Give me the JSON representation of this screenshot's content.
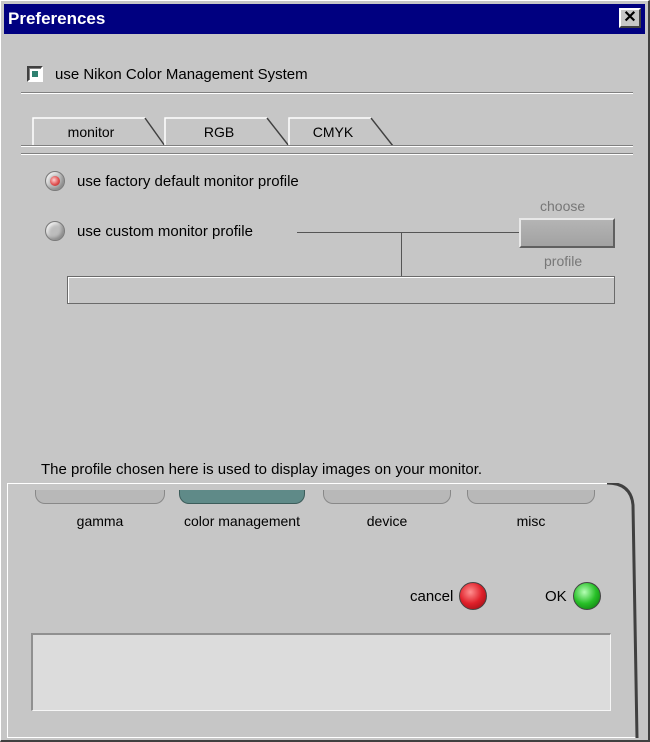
{
  "window": {
    "title": "Preferences",
    "close_glyph": "✕"
  },
  "ncms": {
    "label": "use Nikon Color Management System",
    "checked": true
  },
  "tabs": [
    {
      "label": "monitor",
      "selected": true
    },
    {
      "label": "RGB",
      "selected": false
    },
    {
      "label": "CMYK",
      "selected": false
    }
  ],
  "radios": [
    {
      "label": "use factory default monitor profile",
      "selected": true
    },
    {
      "label": "use custom monitor profile",
      "selected": false
    }
  ],
  "choose_profile": {
    "top_label": "choose",
    "bottom_label": "profile"
  },
  "profile_path": "",
  "hint": "The profile chosen here is used to display images on your monitor.",
  "panel_tabs": [
    {
      "label": "gamma",
      "selected": false
    },
    {
      "label": "color management",
      "selected": true
    },
    {
      "label": "device",
      "selected": false
    },
    {
      "label": "misc",
      "selected": false
    }
  ],
  "actions": {
    "cancel_label": "cancel",
    "ok_label": "OK"
  },
  "info_text": "",
  "colors": {
    "title_bar": "#000080",
    "panel": "#c6c6c6",
    "selected_panel_tab": "#5f8a88",
    "cancel": "#e0202a",
    "ok": "#28c028"
  }
}
